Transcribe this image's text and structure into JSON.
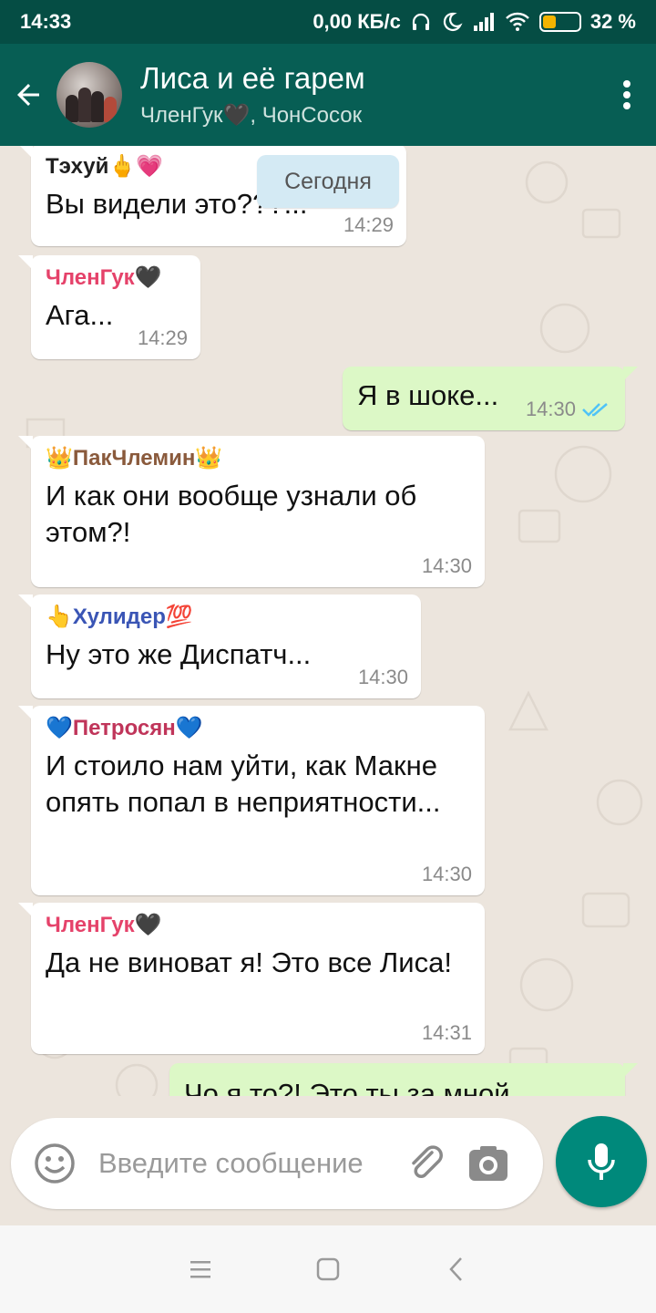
{
  "status_bar": {
    "time": "14:33",
    "network_speed": "0,00 КБ/с",
    "battery_percent": "32 %",
    "icons": [
      "headphones-icon",
      "moon-icon",
      "signal-icon",
      "wifi-icon",
      "battery-icon"
    ]
  },
  "header": {
    "title": "Лиса и её гарем",
    "subtitle": "ЧленГук🖤, ЧонСосок"
  },
  "chat": {
    "date_chip": "Сегодня",
    "messages": [
      {
        "direction": "in",
        "sender": "Тэхуй🖕💗",
        "sender_color": "#1f1f1f",
        "text": "Вы видели это???...",
        "time": "14:29"
      },
      {
        "direction": "in",
        "sender": "ЧленГук🖤",
        "sender_color": "#e5426a",
        "text": "Ага...",
        "time": "14:29"
      },
      {
        "direction": "out",
        "text": "Я в шоке...",
        "time": "14:30",
        "status": "read"
      },
      {
        "direction": "in",
        "sender": "👑ПакЧлемин👑",
        "sender_color": "#8a5a3c",
        "text": "И как они вообще узнали об этом?!",
        "time": "14:30"
      },
      {
        "direction": "in",
        "sender": "👆Хулидер💯",
        "sender_color": "#3a55b5",
        "text": "Ну это же Диспатч...",
        "time": "14:30"
      },
      {
        "direction": "in",
        "sender": "💙Петросян💙",
        "sender_color": "#c0355a",
        "text": "И стоило нам уйти, как Макне опять попал в неприятности...",
        "time": "14:30"
      },
      {
        "direction": "in",
        "sender": "ЧленГук🖤",
        "sender_color": "#e5426a",
        "text": "Да не виноват я! Это все Лиса!",
        "time": "14:31"
      },
      {
        "direction": "out",
        "text": "Чо я то?! Это ты за мной",
        "time": "",
        "status": ""
      }
    ]
  },
  "input": {
    "placeholder": "Введите сообщение",
    "value": ""
  },
  "colors": {
    "header_bg": "#075e54",
    "status_bg": "#054d44",
    "outgoing_bubble": "#dcf8c6",
    "mic_button": "#00897b",
    "read_ticks": "#4fc3f7"
  }
}
